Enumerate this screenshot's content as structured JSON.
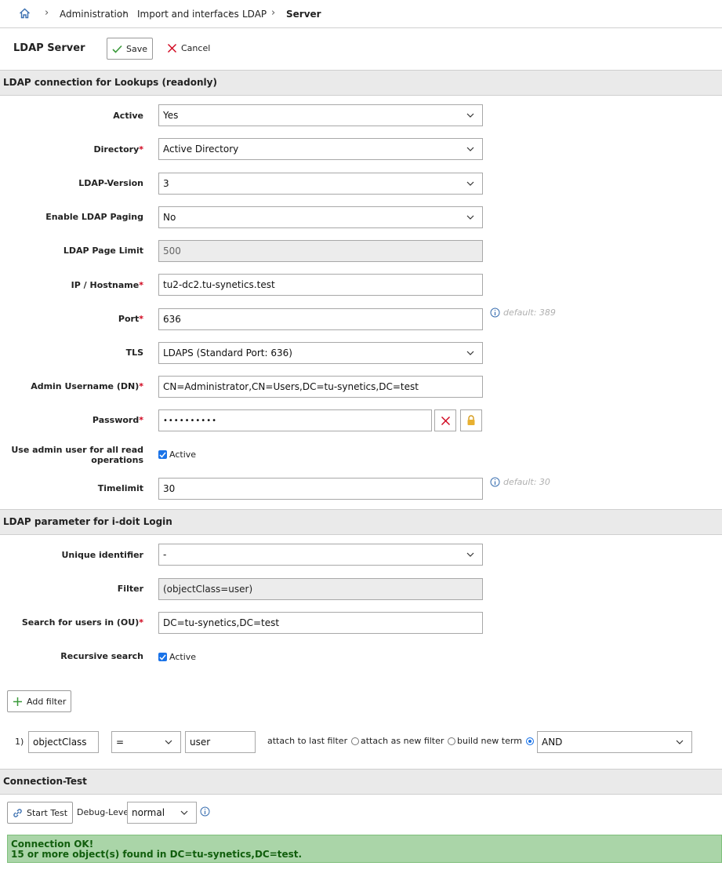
{
  "breadcrumb": [
    "Administration",
    "Import and interfaces",
    "LDAP",
    "Server"
  ],
  "header": {
    "title": "LDAP Server",
    "save_label": "Save",
    "cancel_label": "Cancel"
  },
  "section1": {
    "title": "LDAP connection for Lookups (readonly)"
  },
  "fields": {
    "active": {
      "label": "Active",
      "value": "Yes"
    },
    "directory": {
      "label": "Directory",
      "value": "Active Directory"
    },
    "ldap_version": {
      "label": "LDAP-Version",
      "value": "3"
    },
    "paging": {
      "label": "Enable LDAP Paging",
      "value": "No"
    },
    "page_limit": {
      "label": "LDAP Page Limit",
      "value": "500"
    },
    "hostname": {
      "label": "IP / Hostname",
      "value": "tu2-dc2.tu-synetics.test"
    },
    "port": {
      "label": "Port",
      "value": "636",
      "hint": "default: 389"
    },
    "tls": {
      "label": "TLS",
      "value": "LDAPS (Standard Port: 636)"
    },
    "admin_dn": {
      "label": "Admin Username (DN)",
      "value": "CN=Administrator,CN=Users,DC=tu-synetics,DC=test"
    },
    "password": {
      "label": "Password",
      "value": "••••••••••"
    },
    "admin_read": {
      "label": "Use admin user for all read operations",
      "check_label": "Active"
    },
    "timelimit": {
      "label": "Timelimit",
      "value": "30",
      "hint": "default: 30"
    }
  },
  "section2": {
    "title": "LDAP parameter for i-doit Login"
  },
  "login": {
    "unique_id": {
      "label": "Unique identifier",
      "value": "-"
    },
    "filter": {
      "label": "Filter",
      "value": "(objectClass=user)"
    },
    "search_ou": {
      "label": "Search for users in (OU)",
      "value": "DC=tu-synetics,DC=test"
    },
    "recursive": {
      "label": "Recursive search",
      "check_label": "Active"
    }
  },
  "filters": {
    "add_label": "Add filter",
    "row": {
      "index": "1)",
      "attribute": "objectClass",
      "operator": "=",
      "value": "user",
      "opt_last": "attach to last filter",
      "opt_new": "attach as new filter",
      "opt_term": "build new term",
      "conjunction": "AND"
    }
  },
  "section3": {
    "title": "Connection-Test"
  },
  "test": {
    "start_label": "Start Test",
    "debug_label": "Debug-Level",
    "debug_value": "normal",
    "result_line1": "Connection OK!",
    "result_line2": "15 or more object(s) found in DC=tu-synetics,DC=test."
  }
}
